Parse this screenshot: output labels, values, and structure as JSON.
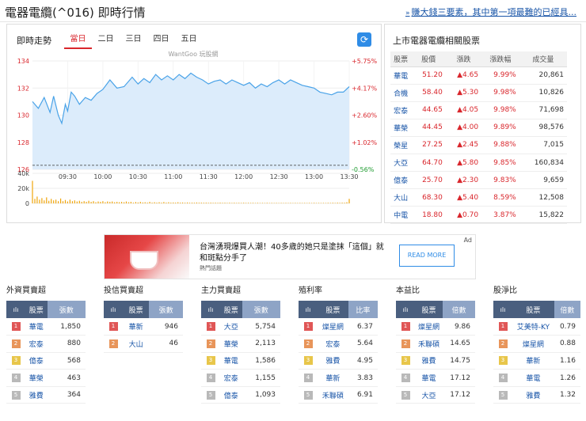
{
  "header": {
    "title": "電器電纜(^016) 即時行情",
    "link_text": "賺大錢三要素，其中第一項最難的已經具..."
  },
  "chart_panel": {
    "title": "即時走勢",
    "tabs": [
      "當日",
      "二日",
      "三日",
      "四日",
      "五日"
    ],
    "active_tab": 0,
    "watermark": "WantGoo 玩股網",
    "refresh_icon": "refresh-icon"
  },
  "chart_data": {
    "type": "area",
    "y_ticks_left": [
      "134",
      "132",
      "130",
      "128",
      "126"
    ],
    "y_ticks_right": [
      "+5.75%",
      "+4.17%",
      "+2.60%",
      "+1.02%",
      "-0.56%"
    ],
    "x_ticks": [
      "09:30",
      "10:00",
      "10:30",
      "11:00",
      "11:30",
      "12:00",
      "12:30",
      "13:00",
      "13:30"
    ],
    "ylim": [
      126,
      134
    ],
    "reference_price": 126.3,
    "x_range": [
      "09:00",
      "13:30"
    ],
    "price": [
      [
        0,
        131.0
      ],
      [
        5,
        130.5
      ],
      [
        10,
        131.3
      ],
      [
        15,
        130.2
      ],
      [
        18,
        131.4
      ],
      [
        22,
        130.0
      ],
      [
        25,
        129.4
      ],
      [
        28,
        130.8
      ],
      [
        30,
        130.3
      ],
      [
        33,
        131.7
      ],
      [
        36,
        131.4
      ],
      [
        40,
        130.8
      ],
      [
        45,
        131.3
      ],
      [
        50,
        131.1
      ],
      [
        55,
        131.6
      ],
      [
        60,
        131.9
      ],
      [
        66,
        132.6
      ],
      [
        72,
        132.0
      ],
      [
        78,
        132.1
      ],
      [
        85,
        132.8
      ],
      [
        90,
        132.3
      ],
      [
        95,
        132.7
      ],
      [
        100,
        132.4
      ],
      [
        105,
        133.0
      ],
      [
        110,
        132.6
      ],
      [
        115,
        132.9
      ],
      [
        120,
        132.6
      ],
      [
        125,
        133.0
      ],
      [
        130,
        132.7
      ],
      [
        135,
        133.1
      ],
      [
        140,
        132.8
      ],
      [
        145,
        132.6
      ],
      [
        150,
        132.3
      ],
      [
        155,
        132.5
      ],
      [
        160,
        132.6
      ],
      [
        165,
        132.3
      ],
      [
        170,
        132.6
      ],
      [
        175,
        132.4
      ],
      [
        180,
        132.2
      ],
      [
        185,
        132.4
      ],
      [
        190,
        132.0
      ],
      [
        195,
        132.3
      ],
      [
        200,
        132.1
      ],
      [
        205,
        132.4
      ],
      [
        210,
        132.6
      ],
      [
        215,
        132.3
      ],
      [
        220,
        132.6
      ],
      [
        225,
        132.4
      ],
      [
        230,
        132.2
      ],
      [
        235,
        132.1
      ],
      [
        240,
        132.0
      ],
      [
        245,
        131.7
      ],
      [
        250,
        131.6
      ],
      [
        255,
        131.5
      ],
      [
        260,
        131.7
      ],
      [
        265,
        131.7
      ],
      [
        270,
        132.1
      ]
    ],
    "volume_ticks": [
      "40k",
      "20k",
      "0"
    ],
    "volume_ylim": [
      0,
      40000
    ],
    "volume": [
      [
        0,
        30000
      ],
      [
        2,
        6000
      ],
      [
        4,
        9000
      ],
      [
        6,
        5000
      ],
      [
        8,
        7000
      ],
      [
        10,
        4000
      ],
      [
        12,
        8000
      ],
      [
        14,
        3500
      ],
      [
        16,
        6000
      ],
      [
        18,
        4000
      ],
      [
        20,
        5000
      ],
      [
        22,
        3000
      ],
      [
        24,
        6500
      ],
      [
        26,
        3000
      ],
      [
        28,
        4500
      ],
      [
        30,
        2500
      ],
      [
        32,
        5000
      ],
      [
        34,
        3000
      ],
      [
        36,
        4000
      ],
      [
        38,
        2500
      ],
      [
        40,
        3500
      ],
      [
        42,
        2000
      ],
      [
        44,
        3000
      ],
      [
        46,
        2000
      ],
      [
        48,
        3500
      ],
      [
        50,
        2000
      ],
      [
        52,
        3000
      ],
      [
        54,
        1500
      ],
      [
        56,
        2500
      ],
      [
        58,
        2000
      ],
      [
        60,
        3000
      ],
      [
        62,
        1500
      ],
      [
        64,
        2500
      ],
      [
        66,
        2000
      ],
      [
        68,
        2500
      ],
      [
        70,
        1500
      ],
      [
        72,
        2000
      ],
      [
        74,
        1500
      ],
      [
        76,
        2000
      ],
      [
        78,
        1500
      ],
      [
        80,
        2500
      ],
      [
        82,
        1500
      ],
      [
        84,
        2000
      ],
      [
        86,
        1000
      ],
      [
        88,
        1800
      ],
      [
        90,
        1200
      ],
      [
        92,
        2000
      ],
      [
        94,
        1200
      ],
      [
        96,
        1500
      ],
      [
        98,
        1000
      ],
      [
        100,
        2000
      ],
      [
        102,
        1000
      ],
      [
        104,
        1500
      ],
      [
        106,
        1000
      ],
      [
        108,
        1500
      ],
      [
        110,
        1000
      ],
      [
        112,
        1800
      ],
      [
        114,
        1000
      ],
      [
        116,
        1500
      ],
      [
        118,
        1000
      ],
      [
        120,
        1200
      ],
      [
        122,
        900
      ],
      [
        124,
        1500
      ],
      [
        126,
        900
      ],
      [
        128,
        1200
      ],
      [
        130,
        800
      ],
      [
        132,
        1200
      ],
      [
        134,
        800
      ],
      [
        136,
        1000
      ],
      [
        138,
        800
      ],
      [
        140,
        1200
      ],
      [
        142,
        800
      ],
      [
        144,
        1000
      ],
      [
        146,
        800
      ],
      [
        148,
        900
      ],
      [
        150,
        700
      ],
      [
        152,
        900
      ],
      [
        154,
        700
      ],
      [
        156,
        800
      ],
      [
        158,
        700
      ],
      [
        160,
        900
      ],
      [
        162,
        700
      ],
      [
        164,
        800
      ],
      [
        166,
        600
      ],
      [
        168,
        800
      ],
      [
        170,
        600
      ],
      [
        172,
        800
      ],
      [
        174,
        600
      ],
      [
        176,
        700
      ],
      [
        178,
        600
      ],
      [
        180,
        800
      ],
      [
        182,
        600
      ],
      [
        184,
        700
      ],
      [
        186,
        600
      ],
      [
        188,
        700
      ],
      [
        190,
        500
      ],
      [
        192,
        700
      ],
      [
        194,
        500
      ],
      [
        196,
        600
      ],
      [
        198,
        500
      ],
      [
        200,
        700
      ],
      [
        202,
        500
      ],
      [
        204,
        600
      ],
      [
        206,
        500
      ],
      [
        208,
        600
      ],
      [
        210,
        500
      ],
      [
        212,
        600
      ],
      [
        214,
        500
      ],
      [
        216,
        600
      ],
      [
        218,
        500
      ],
      [
        220,
        600
      ],
      [
        222,
        500
      ],
      [
        224,
        600
      ],
      [
        226,
        500
      ],
      [
        228,
        600
      ],
      [
        230,
        500
      ],
      [
        232,
        600
      ],
      [
        234,
        500
      ],
      [
        236,
        600
      ],
      [
        238,
        500
      ],
      [
        240,
        700
      ],
      [
        242,
        500
      ],
      [
        244,
        600
      ],
      [
        246,
        500
      ],
      [
        248,
        600
      ],
      [
        250,
        500
      ],
      [
        252,
        700
      ],
      [
        254,
        600
      ],
      [
        256,
        800
      ],
      [
        258,
        600
      ],
      [
        260,
        900
      ],
      [
        262,
        700
      ],
      [
        264,
        1000
      ],
      [
        266,
        800
      ],
      [
        268,
        1500
      ],
      [
        270,
        6000
      ]
    ]
  },
  "related": {
    "title": "上市電器電纜相關股票",
    "headers": [
      "股票",
      "股價",
      "漲跌",
      "漲跌幅",
      "成交量"
    ],
    "rows": [
      {
        "name": "華電",
        "price": "51.20",
        "change": "▲4.65",
        "pct": "9.99%",
        "vol": "20,861"
      },
      {
        "name": "合機",
        "price": "58.40",
        "change": "▲5.30",
        "pct": "9.98%",
        "vol": "10,826"
      },
      {
        "name": "宏泰",
        "price": "44.65",
        "change": "▲4.05",
        "pct": "9.98%",
        "vol": "71,698"
      },
      {
        "name": "華榮",
        "price": "44.45",
        "change": "▲4.00",
        "pct": "9.89%",
        "vol": "98,576"
      },
      {
        "name": "榮星",
        "price": "27.25",
        "change": "▲2.45",
        "pct": "9.88%",
        "vol": "7,015"
      },
      {
        "name": "大亞",
        "price": "64.70",
        "change": "▲5.80",
        "pct": "9.85%",
        "vol": "160,834"
      },
      {
        "name": "億泰",
        "price": "25.70",
        "change": "▲2.30",
        "pct": "9.83%",
        "vol": "9,659"
      },
      {
        "name": "大山",
        "price": "68.30",
        "change": "▲5.40",
        "pct": "8.59%",
        "vol": "12,508"
      },
      {
        "name": "中電",
        "price": "18.80",
        "change": "▲0.70",
        "pct": "3.87%",
        "vol": "15,822"
      }
    ]
  },
  "ad": {
    "text": "台灣湧現爆買人潮！40多歲的她只是塗抹「這個」就和斑點分手了",
    "source": "熱門話題",
    "button": "READ MORE",
    "mark": "Ad"
  },
  "rankings": [
    {
      "title": "外資買賣超",
      "col_icon": "ılı",
      "col_name": "股票",
      "col_val": "張數",
      "rows": [
        [
          "華電",
          "1,850"
        ],
        [
          "宏泰",
          "880"
        ],
        [
          "億泰",
          "568"
        ],
        [
          "華榮",
          "463"
        ],
        [
          "雅費",
          "364"
        ]
      ]
    },
    {
      "title": "投信買賣超",
      "col_icon": "ılı",
      "col_name": "股票",
      "col_val": "張數",
      "rows": [
        [
          "華新",
          "946"
        ],
        [
          "大山",
          "46"
        ]
      ]
    },
    {
      "title": "主力買賣超",
      "col_icon": "ılı",
      "col_name": "股票",
      "col_val": "張數",
      "rows": [
        [
          "大亞",
          "5,754"
        ],
        [
          "華榮",
          "2,113"
        ],
        [
          "華電",
          "1,586"
        ],
        [
          "宏泰",
          "1,155"
        ],
        [
          "億泰",
          "1,093"
        ]
      ]
    },
    {
      "title": "殖利率",
      "col_icon": "ılı",
      "col_name": "股票",
      "col_val": "比率",
      "rows": [
        [
          "燦星網",
          "6.37"
        ],
        [
          "宏泰",
          "5.64"
        ],
        [
          "雅費",
          "4.95"
        ],
        [
          "華新",
          "3.83"
        ],
        [
          "禾聯碩",
          "6.91"
        ]
      ]
    },
    {
      "title": "本益比",
      "col_icon": "ılı",
      "col_name": "股票",
      "col_val": "倍數",
      "rows": [
        [
          "燦星網",
          "9.86"
        ],
        [
          "禾聯碩",
          "14.65"
        ],
        [
          "雅費",
          "14.75"
        ],
        [
          "華電",
          "17.12"
        ],
        [
          "大亞",
          "17.12"
        ]
      ]
    },
    {
      "title": "股淨比",
      "col_icon": "ılı",
      "col_name": "股票",
      "col_val": "倍數",
      "rows": [
        [
          "艾美特-KY",
          "0.79"
        ],
        [
          "燦星網",
          "0.88"
        ],
        [
          "華新",
          "1.16"
        ],
        [
          "華電",
          "1.26"
        ],
        [
          "雅費",
          "1.32"
        ]
      ]
    }
  ]
}
